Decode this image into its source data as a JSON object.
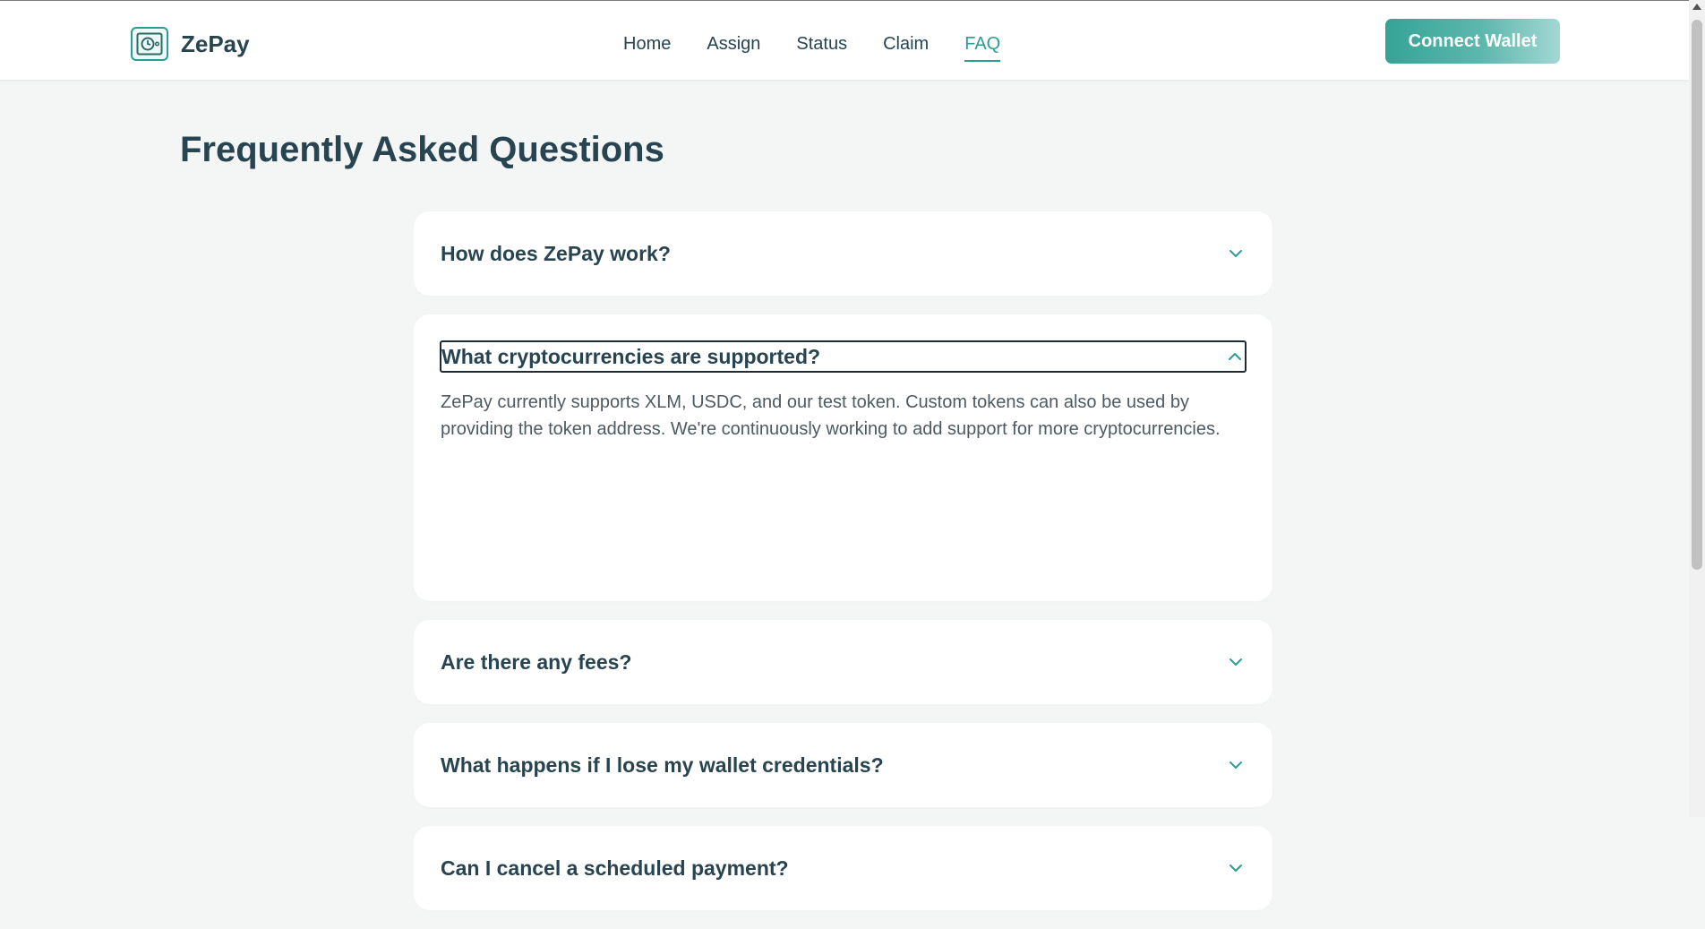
{
  "header": {
    "brand_name": "ZePay",
    "nav": [
      {
        "label": "Home"
      },
      {
        "label": "Assign"
      },
      {
        "label": "Status"
      },
      {
        "label": "Claim"
      },
      {
        "label": "FAQ"
      }
    ],
    "active_nav": "FAQ",
    "connect_label": "Connect Wallet"
  },
  "page": {
    "title": "Frequently Asked Questions"
  },
  "faq": [
    {
      "question": "How does ZePay work?",
      "expanded": false
    },
    {
      "question": "What cryptocurrencies are supported?",
      "expanded": true,
      "answer": "ZePay currently supports XLM, USDC, and our test token. Custom tokens can also be used by providing the token address. We're continuously working to add support for more cryptocurrencies."
    },
    {
      "question": "Are there any fees?",
      "expanded": false
    },
    {
      "question": "What happens if I lose my wallet credentials?",
      "expanded": false
    },
    {
      "question": "Can I cancel a scheduled payment?",
      "expanded": false
    }
  ],
  "colors": {
    "accent": "#2a9d94",
    "text": "#274450",
    "background": "#f4f6f5"
  },
  "icons": {
    "logo": "wallet-safe-icon",
    "expand": "chevron-down-icon",
    "collapse": "chevron-up-icon"
  }
}
